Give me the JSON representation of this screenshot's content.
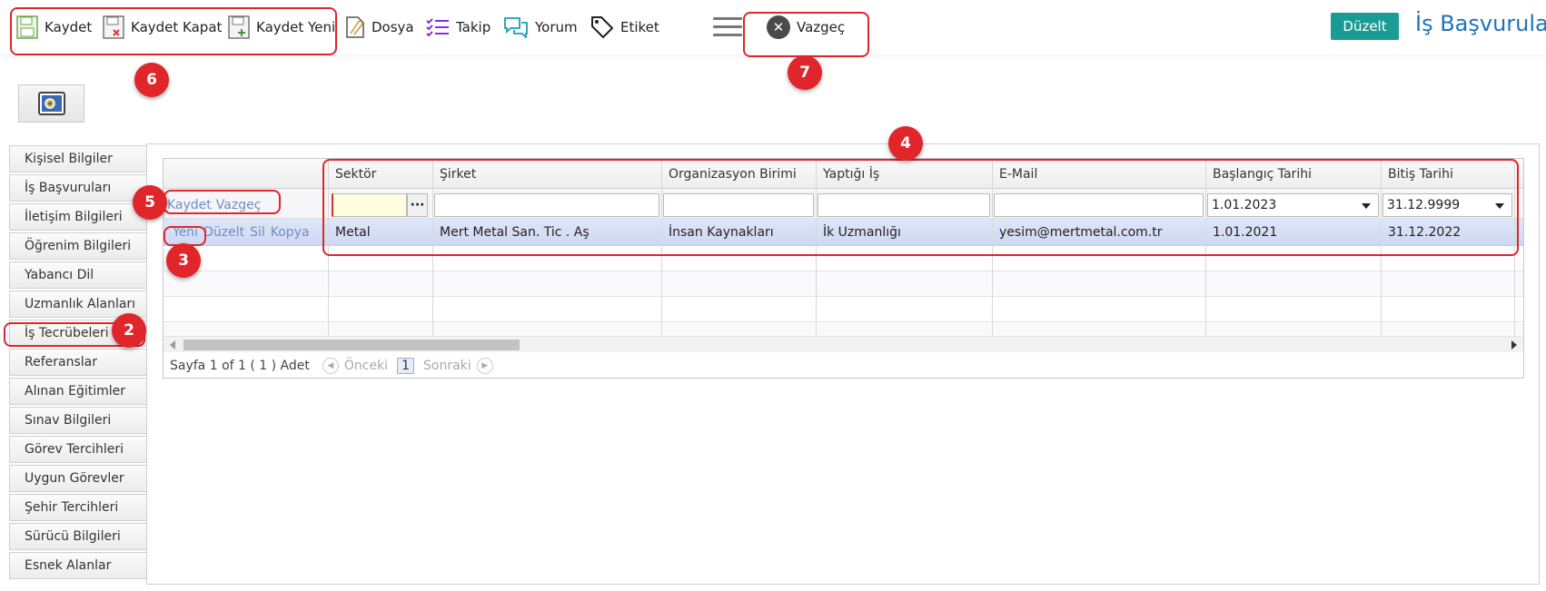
{
  "toolbar": {
    "kaydet": "Kaydet",
    "kaydet_kapat": "Kaydet Kapat",
    "kaydet_yeni": "Kaydet Yeni",
    "dosya": "Dosya",
    "takip": "Takip",
    "yorum": "Yorum",
    "etiket": "Etiket",
    "vazgec": "Vazgeç",
    "duzelt": "Düzelt",
    "title": "İş Başvuruları"
  },
  "badges": [
    "6",
    "7",
    "4",
    "5",
    "3",
    "2"
  ],
  "sidebar": {
    "items": [
      "Kişisel Bilgiler",
      "İş Başvuruları",
      "İletişim Bilgileri",
      "Öğrenim Bilgileri",
      "Yabancı Dil",
      "Uzmanlık Alanları",
      "İş Tecrübeleri",
      "Referanslar",
      "Alınan Eğitimler",
      "Sınav Bilgileri",
      "Görev Tercihleri",
      "Uygun Görevler",
      "Şehir Tercihleri",
      "Sürücü Bilgileri",
      "Esnek Alanlar"
    ],
    "active": "İş Tecrübeleri"
  },
  "grid": {
    "columns": [
      "Sektör",
      "Şirket",
      "Organizasyon Birimi",
      "Yaptığı İş",
      "E-Mail",
      "Başlangıç Tarihi",
      "Bitiş Tarihi"
    ],
    "edit_row": {
      "save": "Kaydet",
      "cancel": "Vazgeç",
      "ellipsis": "···",
      "start_date": "1.01.2023",
      "end_date": "31.12.9999"
    },
    "row_actions": {
      "new": "Yeni",
      "edit": "Düzelt",
      "delete": "Sil",
      "copy": "Kopya"
    },
    "rows": [
      {
        "sektor": "Metal",
        "sirket": "Mert Metal San. Tic . Aş",
        "organizasyon": "İnsan Kaynakları",
        "yaptigi_is": "İk Uzmanlığı",
        "email": "yesim@mertmetal.com.tr",
        "baslangic": "1.01.2021",
        "bitis": "31.12.2022"
      }
    ],
    "pager": {
      "info": "Sayfa 1 of 1 ( 1 ) Adet",
      "prev": "Önceki",
      "page": "1",
      "next": "Sonraki"
    }
  },
  "colors": {
    "accent": "#1a9c95",
    "title": "#1e73be",
    "callout": "#e0262a"
  }
}
